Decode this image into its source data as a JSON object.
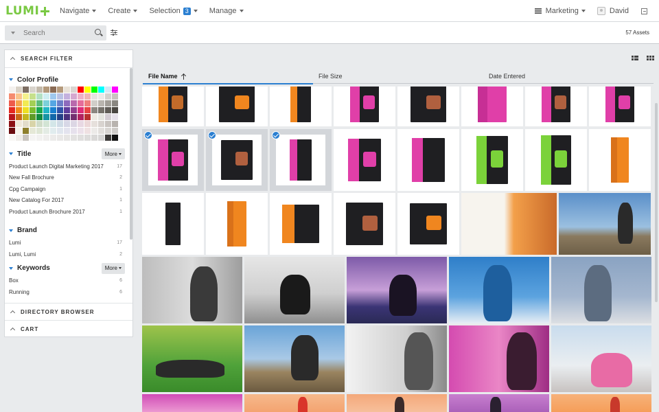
{
  "app": {
    "logo_text": "LUMI",
    "nav": [
      {
        "label": "Navigate"
      },
      {
        "label": "Create"
      },
      {
        "label": "Selection",
        "badge": "3"
      },
      {
        "label": "Manage"
      }
    ],
    "workspace": "Marketing",
    "user": "David"
  },
  "search": {
    "placeholder": "Search",
    "asset_count": "57 Assets"
  },
  "filter": {
    "title": "SEARCH FILTER",
    "color_profile": {
      "label": "Color Profile",
      "swatches": [
        "#f4f1ee",
        "#d9d2c7",
        "#7d6e63",
        "#d8d3cc",
        "#c2b9a9",
        "#b3997b",
        "#8a6b55",
        "#b59a7c",
        "#e9e2d8",
        "#d9d4cf",
        "#ff0000",
        "#ffff00",
        "#00ff00",
        "#00ffff",
        "#d3e7f5",
        "#ff00ff",
        "#f58b6f",
        "#f9c48c",
        "#f4f18c",
        "#c6e08c",
        "#b3e0c4",
        "#cfeef1",
        "#9fc8ee",
        "#b9c1e4",
        "#c4b1de",
        "#d5a8cf",
        "#eeb0c7",
        "#f0b6b5",
        "#e6e3e1",
        "#eae9e8",
        "#d3d1ce",
        "#c8c4bf",
        "#ee5b4b",
        "#f5a54e",
        "#f1ea53",
        "#a3cf55",
        "#5dbb7a",
        "#7cd0d9",
        "#55a6e3",
        "#6c7fc8",
        "#8d6bbd",
        "#b96aad",
        "#e56d9a",
        "#ef7e7c",
        "#d1cec9",
        "#b9b5af",
        "#a19d97",
        "#8a8781",
        "#e5281f",
        "#f28a1a",
        "#ede021",
        "#7cbc2e",
        "#1aa84f",
        "#23b5c4",
        "#1a80cf",
        "#2f52a8",
        "#5f3d9c",
        "#933f8e",
        "#de2d78",
        "#e84444",
        "#8c8780",
        "#75716b",
        "#5f5b56",
        "#4a4742",
        "#b8141a",
        "#c96716",
        "#c3b61c",
        "#5d9a27",
        "#138a3e",
        "#1694a2",
        "#1367a9",
        "#243f86",
        "#4a2f7c",
        "#742f70",
        "#b12360",
        "#b9302f",
        "#eeeae2",
        "#e4e4df",
        "#d3ccd3",
        "#e6e1ea",
        "#8c0f12",
        "#f0e8d8",
        "#e2dcca",
        "#d8d4a8",
        "#cfdcc8",
        "#d2e4d4",
        "#d3e6e8",
        "#cfdbe6",
        "#d7d7e6",
        "#dcd6e4",
        "#e8d8e3",
        "#ecd7d8",
        "#e6e0dc",
        "#d8d3cf",
        "#c9c4c0",
        "#b8b3ae",
        "#6b0c0e",
        "#f7f3ea",
        "#8e7f2d",
        "#e5e8d7",
        "#dfe6d5",
        "#e3ebe4",
        "#e1ecee",
        "#e0e6ee",
        "#e3e3ee",
        "#e6e1ec",
        "#ece1ea",
        "#efe1e2",
        "#eceae8",
        "#e2dfdc",
        "#d8d5d2",
        "#cecbc8",
        "#f9f7f4",
        "#f0ede9",
        "#c9c4bf",
        "#f5f4f3",
        "#f2f1f0",
        "#efeeed",
        "#ecebea",
        "#e9e8e7",
        "#e6e5e4",
        "#e3e2e1",
        "#e0dfde",
        "#dddcdb",
        "#dad9d8",
        "#d7d6d5",
        "#3c3a38",
        "#111111"
      ]
    },
    "title_facet": {
      "label": "Title",
      "more": "More",
      "items": [
        {
          "name": "Product Launch Digital Marketing 2017",
          "count": "17"
        },
        {
          "name": "New Fall Brochure",
          "count": "2"
        },
        {
          "name": "Cpg Campaign",
          "count": "1"
        },
        {
          "name": "New Catalog For 2017",
          "count": "1"
        },
        {
          "name": "Product Launch Brochure 2017",
          "count": "1"
        }
      ]
    },
    "brand_facet": {
      "label": "Brand",
      "items": [
        {
          "name": "Lumi",
          "count": "17"
        },
        {
          "name": "Lumi, Lumi",
          "count": "2"
        }
      ]
    },
    "keywords_facet": {
      "label": "Keywords",
      "more": "More",
      "items": [
        {
          "name": "Box",
          "count": "6"
        },
        {
          "name": "Running",
          "count": "6"
        }
      ]
    },
    "directory_browser": "DIRECTORY BROWSER",
    "cart": "CART"
  },
  "columns": [
    "File Name",
    "File Size",
    "Date Entered"
  ],
  "accent": "#2b7fd1",
  "brand_green": "#7ac943"
}
